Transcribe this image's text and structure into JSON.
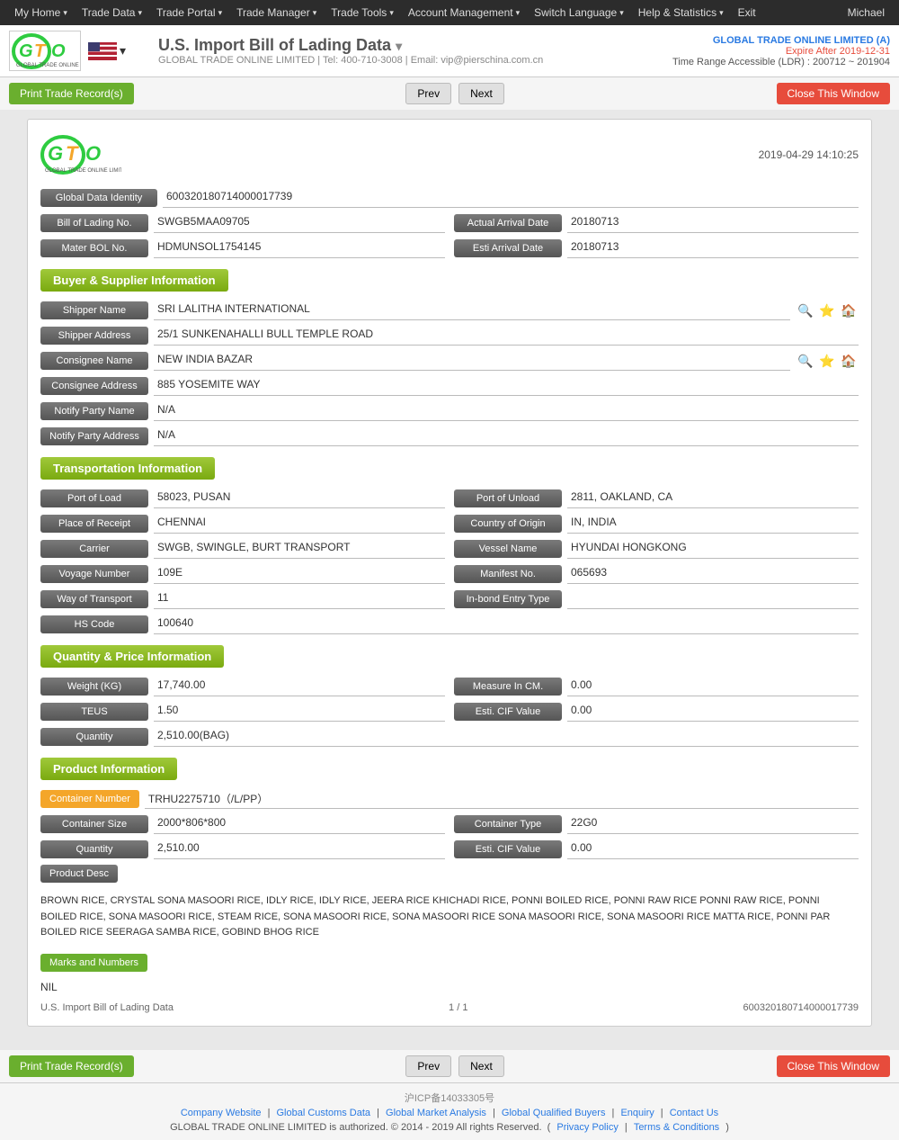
{
  "nav": {
    "items": [
      {
        "label": "My Home",
        "has_arrow": true
      },
      {
        "label": "Trade Data",
        "has_arrow": true
      },
      {
        "label": "Trade Portal",
        "has_arrow": true
      },
      {
        "label": "Trade Manager",
        "has_arrow": true
      },
      {
        "label": "Trade Tools",
        "has_arrow": true
      },
      {
        "label": "Account Management",
        "has_arrow": true
      },
      {
        "label": "Switch Language",
        "has_arrow": true
      },
      {
        "label": "Help & Statistics",
        "has_arrow": true
      },
      {
        "label": "Exit",
        "has_arrow": false
      }
    ],
    "username": "Michael"
  },
  "header": {
    "title": "U.S. Import Bill of Lading Data",
    "subtitle_company": "GLOBAL TRADE ONLINE LIMITED",
    "subtitle_tel": "Tel: 400-710-3008",
    "subtitle_email": "Email: vip@pierschina.com.cn",
    "account_company": "GLOBAL TRADE ONLINE LIMITED (A)",
    "account_expire": "Expire After 2019-12-31",
    "account_range": "Time Range Accessible (LDR) : 200712 ~ 201904"
  },
  "toolbar": {
    "print_label": "Print Trade Record(s)",
    "prev_label": "Prev",
    "next_label": "Next",
    "close_label": "Close This Window"
  },
  "record": {
    "datetime": "2019-04-29 14:10:25",
    "global_data_identity": "600320180714000017739",
    "bill_of_lading_no": "SWGB5MAA09705",
    "actual_arrival_date_label": "Actual Arrival Date",
    "actual_arrival_date": "20180713",
    "mater_bol_no_label": "Mater BOL No.",
    "mater_bol_no": "HDMUNSOL1754145",
    "esti_arrival_date_label": "Esti Arrival Date",
    "esti_arrival_date": "20180713"
  },
  "buyer_supplier": {
    "section_title": "Buyer & Supplier Information",
    "shipper_name": "SRI LALITHA INTERNATIONAL",
    "shipper_address": "25/1 SUNKENAHALLI BULL TEMPLE ROAD",
    "consignee_name": "NEW INDIA BAZAR",
    "consignee_address": "885 YOSEMITE WAY",
    "notify_party_name": "N/A",
    "notify_party_address": "N/A"
  },
  "transportation": {
    "section_title": "Transportation Information",
    "port_of_load_label": "Port of Load",
    "port_of_load": "58023, PUSAN",
    "port_of_unload_label": "Port of Unload",
    "port_of_unload": "2811, OAKLAND, CA",
    "place_of_receipt_label": "Place of Receipt",
    "place_of_receipt": "CHENNAI",
    "country_of_origin_label": "Country of Origin",
    "country_of_origin": "IN, INDIA",
    "carrier_label": "Carrier",
    "carrier": "SWGB, SWINGLE, BURT TRANSPORT",
    "vessel_name_label": "Vessel Name",
    "vessel_name": "HYUNDAI HONGKONG",
    "voyage_number_label": "Voyage Number",
    "voyage_number": "109E",
    "manifest_no_label": "Manifest No.",
    "manifest_no": "065693",
    "way_of_transport_label": "Way of Transport",
    "way_of_transport": "11",
    "inbond_entry_type_label": "In-bond Entry Type",
    "inbond_entry_type": "",
    "hs_code_label": "HS Code",
    "hs_code": "100640"
  },
  "quantity_price": {
    "section_title": "Quantity & Price Information",
    "weight_label": "Weight (KG)",
    "weight": "17,740.00",
    "measure_label": "Measure In CM.",
    "measure": "0.00",
    "teus_label": "TEUS",
    "teus": "1.50",
    "esti_cif_label": "Esti. CIF Value",
    "esti_cif": "0.00",
    "quantity_label": "Quantity",
    "quantity": "2,510.00(BAG)"
  },
  "product": {
    "section_title": "Product Information",
    "container_number_label": "Container Number",
    "container_number": "TRHU2275710（/L/PP）",
    "container_size_label": "Container Size",
    "container_size": "2000*806*800",
    "container_type_label": "Container Type",
    "container_type": "22G0",
    "quantity_label": "Quantity",
    "quantity": "2,510.00",
    "esti_cif_label": "Esti. CIF Value",
    "esti_cif": "0.00",
    "product_desc_label": "Product Desc",
    "product_desc": "BROWN RICE, CRYSTAL SONA MASOORI RICE, IDLY RICE, IDLY RICE, JEERA RICE KHICHADI RICE, PONNI BOILED RICE, PONNI RAW RICE PONNI RAW RICE, PONNI BOILED RICE, SONA MASOORI RICE, STEAM RICE, SONA MASOORI RICE, SONA MASOORI RICE SONA MASOORI RICE, SONA MASOORI RICE MATTA RICE, PONNI PAR BOILED RICE SEERAGA SAMBA RICE, GOBIND BHOG RICE",
    "marks_label": "Marks and Numbers",
    "marks": "NIL"
  },
  "card_footer": {
    "left": "U.S. Import Bill of Lading Data",
    "center": "1 / 1",
    "right": "600320180714000017739"
  },
  "bottom_toolbar": {
    "print_label": "Print Trade Record(s)",
    "prev_label": "Prev",
    "next_label": "Next",
    "close_label": "Close This Window"
  },
  "footer": {
    "icp": "沪ICP备14033305号",
    "links": [
      "Company Website",
      "Global Customs Data",
      "Global Market Analysis",
      "Global Qualified Buyers",
      "Enquiry",
      "Contact Us"
    ],
    "copyright": "GLOBAL TRADE ONLINE LIMITED is authorized. © 2014 - 2019 All rights Reserved.",
    "policy_links": [
      "Privacy Policy",
      "Terms & Conditions"
    ]
  }
}
